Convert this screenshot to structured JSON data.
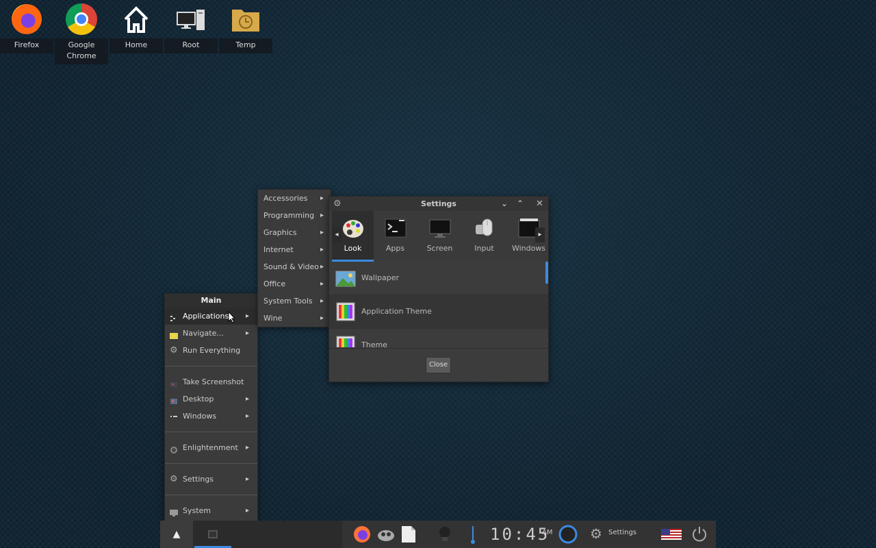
{
  "desktop": {
    "icons": [
      {
        "label": "Firefox"
      },
      {
        "label": "Google\nChrome"
      },
      {
        "label": "Home"
      },
      {
        "label": "Root"
      },
      {
        "label": "Temp"
      }
    ]
  },
  "main_menu": {
    "title": "Main",
    "items": [
      {
        "label": "Applications",
        "icon": "applications-icon"
      },
      {
        "label": "Navigate...",
        "icon": "folder-icon"
      },
      {
        "label": "Run Everything",
        "icon": "gear-icon"
      },
      {
        "label": "Take Screenshot",
        "icon": "screenshot-icon"
      },
      {
        "label": "Desktop",
        "icon": "desktop-icon"
      },
      {
        "label": "Windows",
        "icon": "windows-icon"
      },
      {
        "label": "Enlightenment",
        "icon": "enlightenment-icon"
      },
      {
        "label": "Settings",
        "icon": "gear-icon"
      },
      {
        "label": "System",
        "icon": "monitor-icon"
      }
    ]
  },
  "applications_menu": {
    "items": [
      "Accessories",
      "Programming",
      "Graphics",
      "Internet",
      "Sound & Video",
      "Office",
      "System Tools",
      "Wine"
    ]
  },
  "settings_window": {
    "title": "Settings",
    "tabs": [
      {
        "label": "Look",
        "selected": true
      },
      {
        "label": "Apps"
      },
      {
        "label": "Screen"
      },
      {
        "label": "Input"
      },
      {
        "label": "Windows"
      }
    ],
    "list": [
      {
        "label": "Wallpaper"
      },
      {
        "label": "Application Theme"
      },
      {
        "label": "Theme"
      }
    ],
    "close_label": "Close"
  },
  "taskbar": {
    "clock": "10:45",
    "ampm": "AM",
    "settings_label": "Settings"
  },
  "colors": {
    "accent": "#3c8ae0"
  }
}
